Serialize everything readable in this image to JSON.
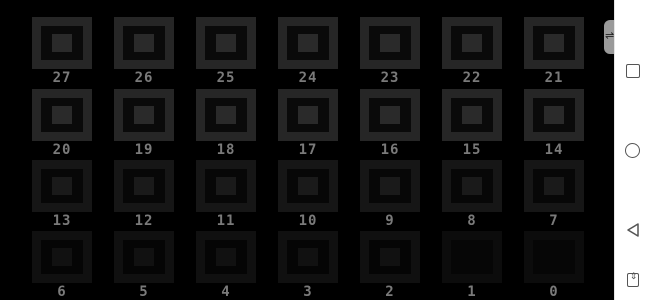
{
  "grid": {
    "rows": [
      {
        "tiles": [
          {
            "label": "27",
            "state": "normal"
          },
          {
            "label": "26",
            "state": "normal"
          },
          {
            "label": "25",
            "state": "normal"
          },
          {
            "label": "24",
            "state": "normal"
          },
          {
            "label": "23",
            "state": "normal"
          },
          {
            "label": "22",
            "state": "normal"
          },
          {
            "label": "21",
            "state": "normal"
          }
        ]
      },
      {
        "tiles": [
          {
            "label": "20",
            "state": "normal"
          },
          {
            "label": "19",
            "state": "normal"
          },
          {
            "label": "18",
            "state": "normal"
          },
          {
            "label": "17",
            "state": "normal"
          },
          {
            "label": "16",
            "state": "normal"
          },
          {
            "label": "15",
            "state": "normal"
          },
          {
            "label": "14",
            "state": "normal"
          }
        ]
      },
      {
        "tiles": [
          {
            "label": "13",
            "state": "dim"
          },
          {
            "label": "12",
            "state": "dim"
          },
          {
            "label": "11",
            "state": "dim"
          },
          {
            "label": "10",
            "state": "dim"
          },
          {
            "label": "9",
            "state": "dim"
          },
          {
            "label": "8",
            "state": "dim"
          },
          {
            "label": "7",
            "state": "dim"
          }
        ]
      },
      {
        "tiles": [
          {
            "label": "6",
            "state": "faint"
          },
          {
            "label": "5",
            "state": "faint"
          },
          {
            "label": "4",
            "state": "faint"
          },
          {
            "label": "3",
            "state": "faint"
          },
          {
            "label": "2",
            "state": "faint"
          },
          {
            "label": "1",
            "state": "empty"
          },
          {
            "label": "0",
            "state": "empty"
          }
        ]
      }
    ]
  },
  "navbar": {
    "icons": [
      "square-icon",
      "circle-icon",
      "triangle-back-icon",
      "expand-icon"
    ],
    "background": "#ffffff"
  },
  "side_handle": {
    "glyph": "⇌"
  },
  "colors": {
    "background": "#000000",
    "label": "#7a7a7a"
  }
}
